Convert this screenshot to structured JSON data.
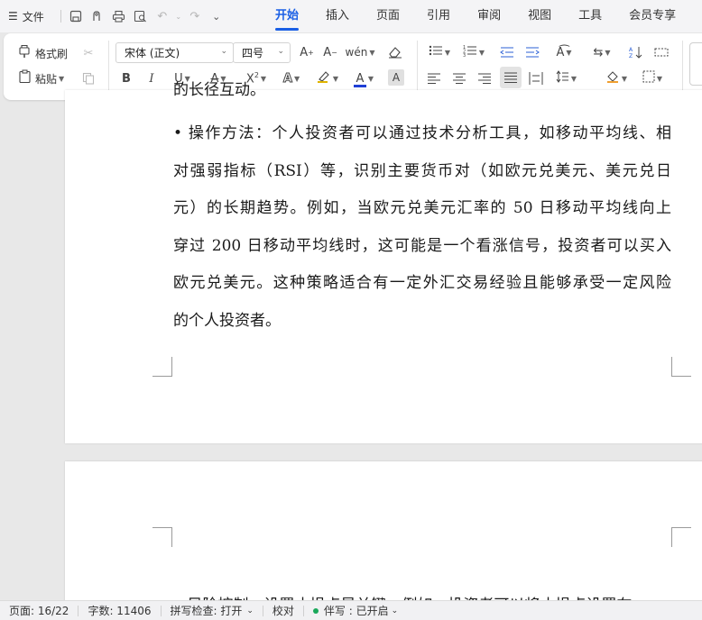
{
  "menubar": {
    "file_label": "文件",
    "tabs": [
      "开始",
      "插入",
      "页面",
      "引用",
      "审阅",
      "视图",
      "工具",
      "会员专享"
    ]
  },
  "ribbon": {
    "format_painter": "格式刷",
    "paste": "粘贴",
    "font_name": "宋体 (正文)",
    "font_size": "四号",
    "font_color": "#1f3fd6"
  },
  "document": {
    "cut_top_line": "的长径互动。",
    "paragraph_lines": [
      "• 操作方法：个人投资者可以通过技术分析工具，如移动平均线、相",
      "对强弱指标（RSI）等，识别主要货币对（如欧元兑美元、美元兑日",
      "元）的长期趋势。例如，当欧元兑美元汇率的 50 日移动平均线向上",
      "穿过 200 日移动平均线时，这可能是一个看涨信号，投资者可以买入",
      "欧元兑美元。这种策略适合有一定外汇交易经验且能够承受一定风险",
      "的个人投资者。"
    ],
    "page2_cut_line": "• 风险控制：设置止损点是关键。例如，投资者可以将止损点设置在"
  },
  "status": {
    "page": "页面: 16/22",
    "words": "字数: 11406",
    "spell": "拼写检查: 打开",
    "proof": "校对",
    "companion": "伴写 : 已开启"
  }
}
